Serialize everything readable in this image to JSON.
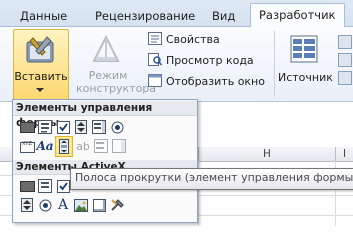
{
  "tabs": [
    "Данные",
    "Рецензирование",
    "Вид",
    "Разработчик"
  ],
  "active_tab_index": 3,
  "ribbon": {
    "insert_label": "Вставить",
    "design_mode_label_1": "Режим",
    "design_mode_label_2": "конструктора",
    "properties_label": "Свойства",
    "view_code_label": "Просмотр кода",
    "show_window_label": "Отобразить окно",
    "source_label": "Источник"
  },
  "sheet": {
    "column_h": "H",
    "column_i": "I"
  },
  "dropdown": {
    "form_controls_header": "Элементы управления формы",
    "activex_header": "Элементы ActiveX"
  },
  "tooltip": "Полоса прокрутки (элемент управления формы)",
  "colors": {
    "accent": "#2b579a",
    "highlight": "#fde58a",
    "ribbon_border": "#a9bedb"
  }
}
